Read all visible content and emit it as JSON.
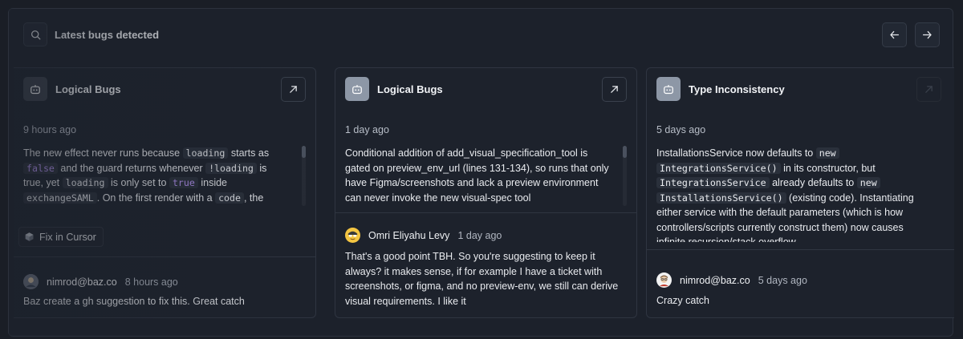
{
  "header": {
    "title": "Latest bugs detected",
    "icon": "search-icon"
  },
  "nav": {
    "prev_icon": "arrow-left-icon",
    "next_icon": "arrow-right-icon"
  },
  "cards": [
    {
      "category": "Logical Bugs",
      "time": "9 hours ago",
      "body_parts": {
        "t1": "The new effect never runs because ",
        "c1": "loading",
        "t2": " starts as ",
        "c2": "false",
        "t3": " and the guard returns whenever ",
        "c3": "!loading",
        "t4": " is true, yet ",
        "c4": "loading",
        "t5": " is only set to ",
        "c5": "true",
        "t6": " inside ",
        "c6": "exchangeSAML",
        "t7": ". On the first render with a ",
        "c7": "code",
        "t8": ", the guard immediately exits so"
      },
      "fix_label": "Fix in Cursor",
      "comment": {
        "author": "nimrod@baz.co",
        "time": "8 hours ago",
        "text": "Baz create a gh suggestion to fix this. Great catch"
      }
    },
    {
      "category": "Logical Bugs",
      "time": "1 day ago",
      "body": "Conditional addition of add_visual_specification_tool is gated on preview_env_url (lines 131-134), so runs that only have Figma/screenshots and lack a preview environment can never invoke the new visual-spec tool",
      "comment": {
        "author": "Omri Eliyahu Levy",
        "time": "1 day ago",
        "text": "That's a good point TBH. So you're suggesting to keep it always? it makes sense, if for example I have a ticket with screenshots, or figma, and no preview-env, we still can derive visual requirements. I like it"
      }
    },
    {
      "category": "Type Inconsistency",
      "time": "5 days ago",
      "body_parts": {
        "t1": "InstallationsService now defaults to ",
        "c1": "new InstallationsService()",
        "c1a": "new",
        "c1b": "IntegrationsService()",
        "t2": " in its constructor, but ",
        "c2": "IntegrationsService",
        "t3": " already defaults to ",
        "c3a": "new",
        "c3b": "InstallationsService()",
        "t4": " (existing code). Instantiating either service with the default parameters (which is how controllers/scripts currently construct them) now causes infinite recursion/stack overflow"
      },
      "comment": {
        "author": "nimrod@baz.co",
        "time": "5 days ago",
        "text": "Crazy catch"
      }
    }
  ],
  "colors": {
    "bot_icon_bg": "#8d97a6",
    "keyword": "#b794f6"
  }
}
